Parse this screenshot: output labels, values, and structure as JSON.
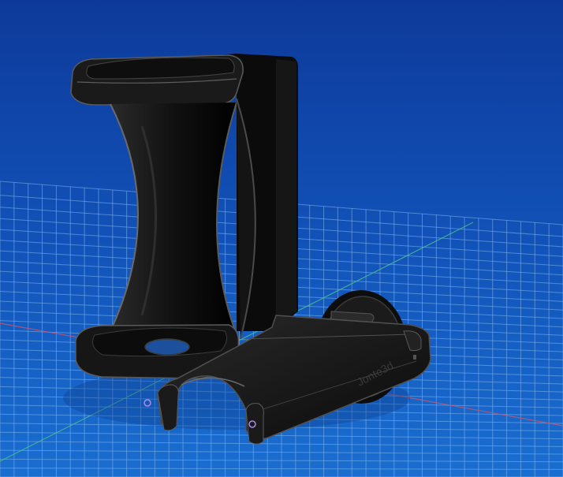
{
  "viewport": {
    "background_top": "#0f3d9e",
    "background_bottom": "#1666c8",
    "grid_color": "#8fbff0",
    "axis_x_color": "#d0556a",
    "axis_y_color": "#4cc08a"
  },
  "model": {
    "body_color": "#141414",
    "highlight_color": "#6a6a6a",
    "engraving_text": "Jonte3d"
  }
}
